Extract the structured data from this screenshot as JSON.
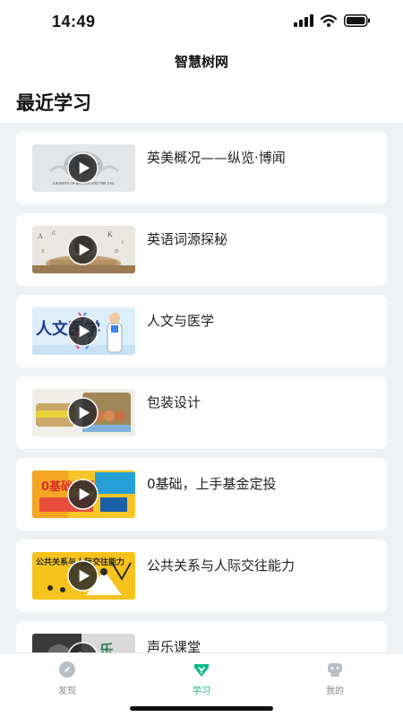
{
  "status_bar": {
    "time": "14:49",
    "icons": [
      "cellular-signal-icon",
      "wifi-icon",
      "battery-icon"
    ]
  },
  "nav": {
    "title": "智慧树网"
  },
  "section": {
    "title": "最近学习"
  },
  "courses": [
    {
      "title": "英美概况——纵览·博闻",
      "thumb_caption": "A SURVEY OF BRITAIN AND THE USA"
    },
    {
      "title": "英语词源探秘"
    },
    {
      "title": "人文与医学",
      "thumb_caption": "人文医学"
    },
    {
      "title": "包装设计"
    },
    {
      "title": "0基础，上手基金定投",
      "thumb_caption": "0基础手投"
    },
    {
      "title": "公共关系与人际交往能力",
      "thumb_caption": "公共关系与人际交往能力"
    },
    {
      "title": "声乐课堂",
      "thumb_caption": "乐"
    }
  ],
  "tabs": [
    {
      "label": "发现",
      "icon": "compass-icon",
      "active": false
    },
    {
      "label": "学习",
      "icon": "learning-icon",
      "active": true
    },
    {
      "label": "我的",
      "icon": "profile-icon",
      "active": false
    }
  ],
  "colors": {
    "accent": "#10b98a",
    "list_background": "#eef2f5",
    "card_background": "#ffffff",
    "inactive_tab": "#888888"
  }
}
